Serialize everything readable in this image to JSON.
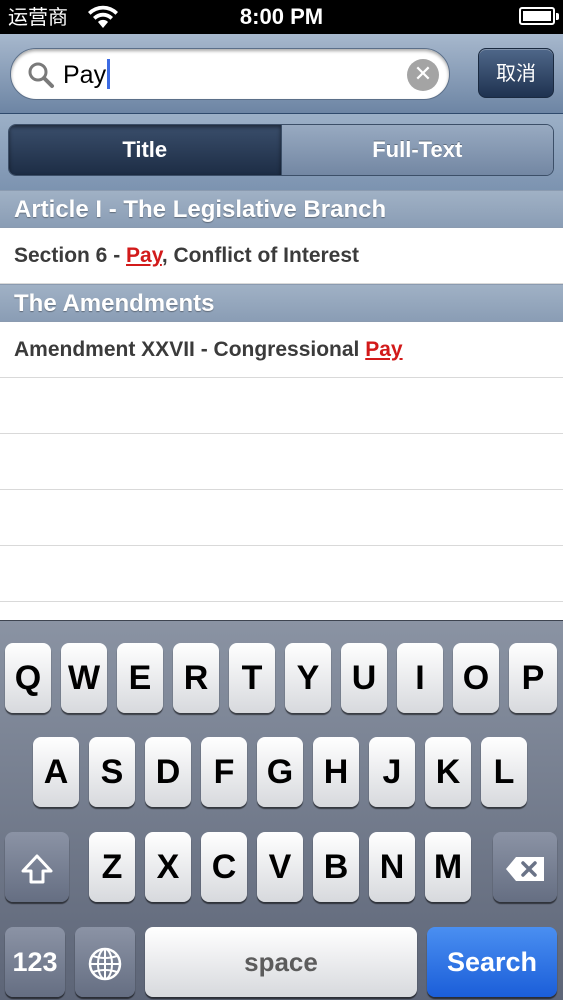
{
  "status_bar": {
    "carrier": "运营商",
    "time": "8:00 PM",
    "wifi_icon": "wifi-icon",
    "battery_icon": "battery-icon"
  },
  "search": {
    "query": "Pay",
    "cancel_label": "取消",
    "search_icon": "magnifier-icon",
    "clear_icon": "clear-icon",
    "caret_color": "#3c6be3"
  },
  "scope": {
    "options": [
      "Title",
      "Full-Text"
    ],
    "selected": "Title"
  },
  "results": {
    "highlight_color": "#d21a1a",
    "sections": [
      {
        "header": "Article I - The Legislative Branch",
        "rows": [
          {
            "before": "Section 6 - ",
            "match": "Pay",
            "after": ", Conflict of Interest"
          }
        ]
      },
      {
        "header": "The Amendments",
        "rows": [
          {
            "before": "Amendment XXVII - Congressional ",
            "match": "Pay",
            "after": ""
          }
        ]
      }
    ]
  },
  "keyboard": {
    "row1": [
      "Q",
      "W",
      "E",
      "R",
      "T",
      "Y",
      "U",
      "I",
      "O",
      "P"
    ],
    "row2": [
      "A",
      "S",
      "D",
      "F",
      "G",
      "H",
      "J",
      "K",
      "L"
    ],
    "row3": [
      "Z",
      "X",
      "C",
      "V",
      "B",
      "N",
      "M"
    ],
    "shift_icon": "shift-icon",
    "delete_icon": "delete-icon",
    "numbers_label": "123",
    "globe_icon": "globe-icon",
    "space_label": "space",
    "search_label": "Search",
    "search_key_color": "#1b5ed9"
  }
}
